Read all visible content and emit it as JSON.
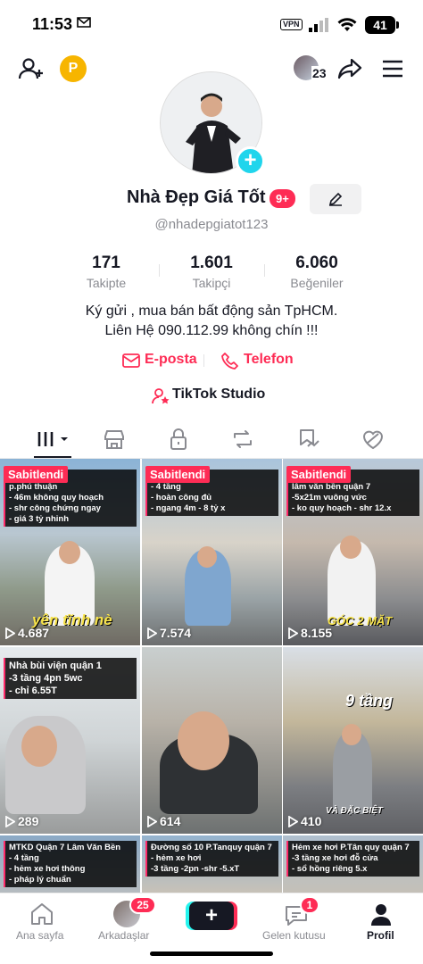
{
  "status_bar": {
    "time": "11:53",
    "vpn": "VPN",
    "battery": "41"
  },
  "header": {
    "coin_label": "P",
    "friends_count": "23"
  },
  "profile": {
    "display_name": "Nhà Đẹp Giá Tốt",
    "name_badge": "9+",
    "username": "@nhadepgiatot123",
    "stats": [
      {
        "value": "171",
        "label": "Takipte"
      },
      {
        "value": "1.601",
        "label": "Takipçi"
      },
      {
        "value": "6.060",
        "label": "Beğeniler"
      }
    ],
    "bio_line1": "Ký gửi , mua bán bất động sản TpHCM.",
    "bio_line2": "Liên Hệ 090.112.99 không chín !!!",
    "email_label": "E-posta",
    "phone_label": "Telefon",
    "studio_label": "TikTok Studio"
  },
  "videos": [
    {
      "pinned": "Sabitlendi",
      "text": "tâm quận 7\np.phú thuận\n- 46m không quy hoạch\n- shr công chứng ngay\n- giá 3 tỷ nhỉnh",
      "views": "4.687",
      "caption": "yên tĩnh nè"
    },
    {
      "pinned": "Sabitlendi",
      "text": "h nguyễn thị\n- 4 tầng\n- hoàn công đủ\n- ngang 4m - 8 tỷ x",
      "views": "7.574",
      "caption": ""
    },
    {
      "pinned": "Sabitlendi",
      "text": "đường số\nlâm văn bền quận 7\n-5x21m vuông vức\n- ko quy hoạch - shr 12.x",
      "views": "8.155",
      "caption": "GÓC 2 MẶT"
    },
    {
      "pinned": "",
      "text": "Nhà bùi viện quận 1\n-3 tầng 4pn 5wc\n- chỉ 6.55T",
      "views": "289",
      "caption": ""
    },
    {
      "pinned": "",
      "text": "",
      "views": "614",
      "caption": ""
    },
    {
      "pinned": "",
      "text": "",
      "views": "410",
      "caption": "9 tầng"
    },
    {
      "pinned": "",
      "text": "MTKD Quận 7 Lâm Văn Bền\n- 4 tầng\n- hẻm xe hơi thông\n- pháp lý chuẩn",
      "views": "",
      "caption": ""
    },
    {
      "pinned": "",
      "text": "Đường số 10 P.Tanquy quận 7\n- hẻm xe hơi\n-3 tầng -2pn -shr -5.xT",
      "views": "",
      "caption": ""
    },
    {
      "pinned": "",
      "text": "Hẻm xe hơi P.Tân quy quận 7\n-3 tầng xe hơi đỗ cửa\n- sổ hồng riêng 5.x",
      "views": "",
      "caption": ""
    }
  ],
  "video_caption_extra": "VÀ ĐẶC BIỆT",
  "bottom_nav": {
    "home": "Ana sayfa",
    "friends": "Arkadaşlar",
    "friends_badge": "25",
    "inbox": "Gelen kutusu",
    "inbox_badge": "1",
    "profile": "Profil",
    "plus": "+"
  },
  "colors": {
    "accent": "#fe2c55",
    "cyan": "#20d5ec",
    "coin": "#f7b500"
  }
}
